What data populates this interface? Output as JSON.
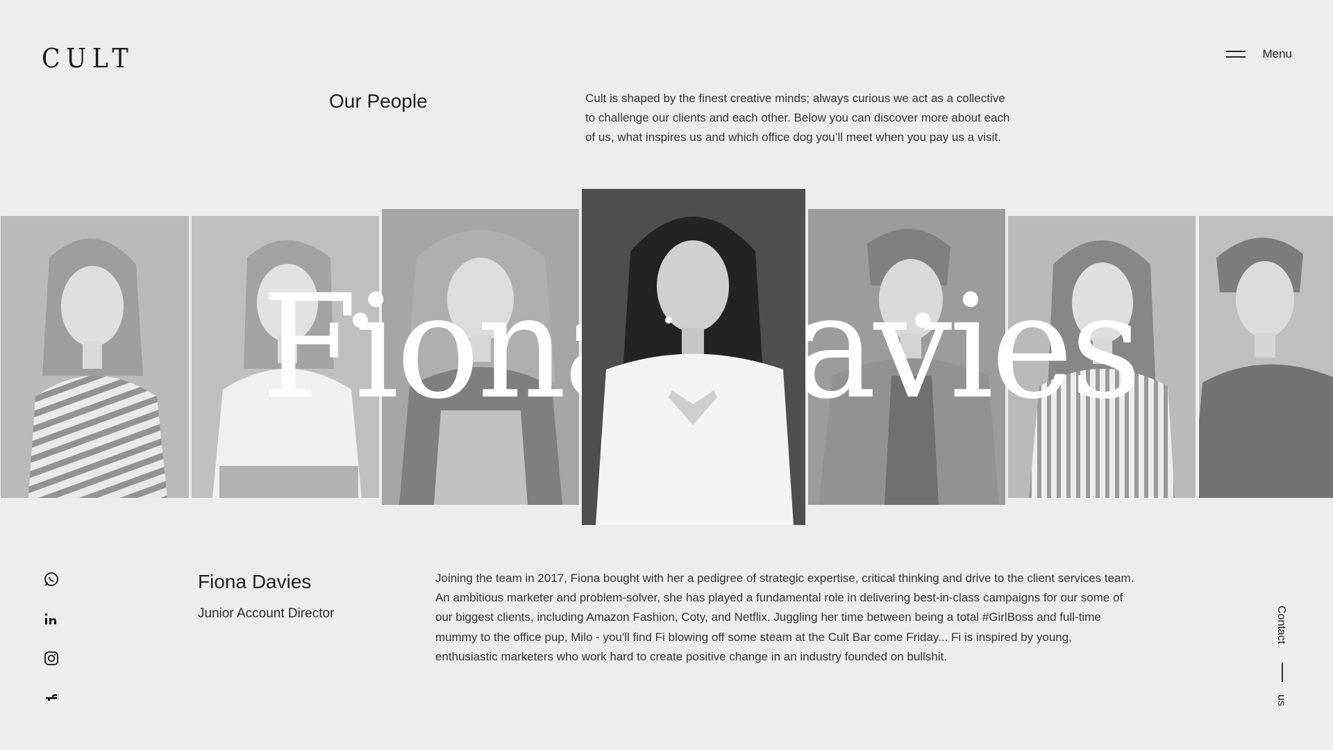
{
  "header": {
    "logo": "CULT",
    "menu_label": "Menu"
  },
  "section": {
    "title": "Our People",
    "intro": "Cult is shaped by the finest creative minds; always curious we act as a collective to challenge our clients and each other. Below you can discover more about each of us, what inspires us and which office dog you’ll meet when you pay us a visit."
  },
  "carousel": {
    "featured_name": "Fiona Davies",
    "active_index": 3,
    "cards": [
      {
        "portrait": "woman-striped-sweater"
      },
      {
        "portrait": "woman-white-tshirt"
      },
      {
        "portrait": "woman-curly-hair-pinafore"
      },
      {
        "portrait": "woman-dark-hair-white-blouse"
      },
      {
        "portrait": "man-denim-jacket"
      },
      {
        "portrait": "woman-striped-shirt"
      },
      {
        "portrait": "man-black-tshirt"
      }
    ]
  },
  "social": {
    "icons": [
      "whatsapp-icon",
      "linkedin-icon",
      "instagram-icon",
      "facebook-icon"
    ]
  },
  "person": {
    "name": "Fiona Davies",
    "role": "Junior Account Director",
    "bio": "Joining the team in 2017, Fiona bought with her a pedigree of strategic expertise, critical thinking and drive to the client services team. An ambitious marketer and problem-solver, she has played a fundamental role in delivering best-in-class campaigns for our some of our biggest clients, including Amazon Fashion, Coty, and Netflix. Juggling her time between being a total #GirlBoss and full-time mummy to the office pup, Milo - you'll find Fi blowing off some steam at the Cult Bar come Friday... Fi is inspired by young, enthusiastic marketers who work hard to create positive change in an industry founded on bullshit."
  },
  "contact": {
    "label_top": "Contact",
    "label_bottom": "us"
  },
  "colors": {
    "background": "#ededed",
    "text": "#1e1e1e",
    "overlay_text": "#ffffff"
  }
}
